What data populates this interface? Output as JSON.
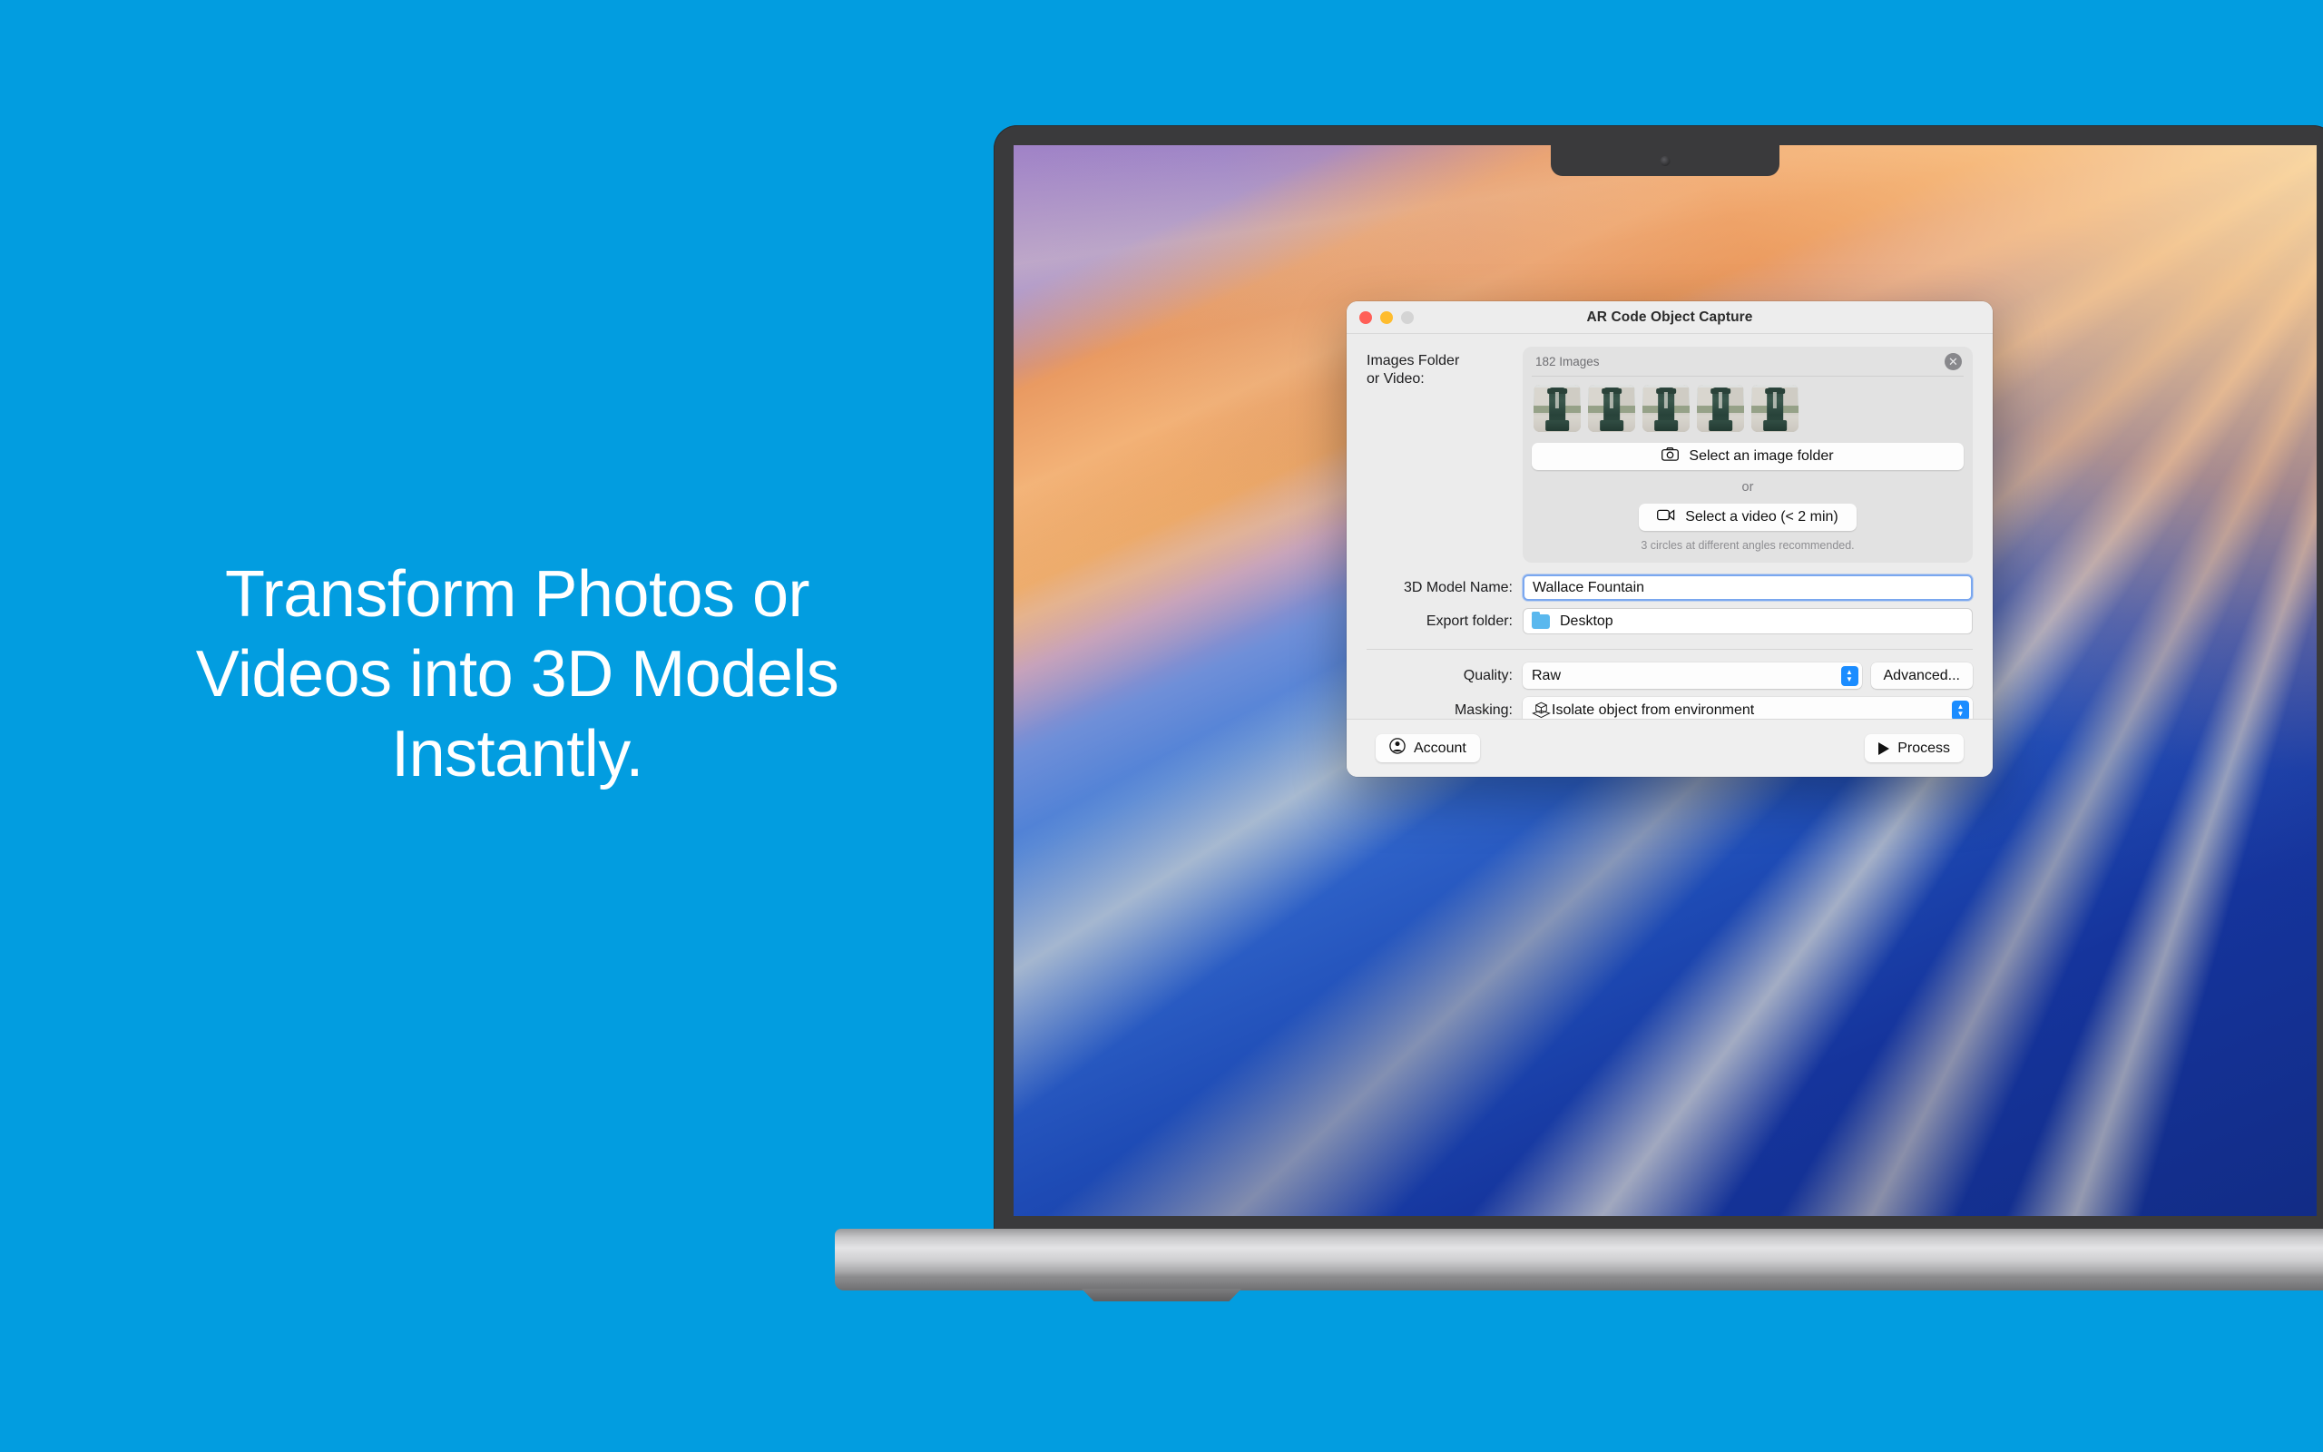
{
  "marketing": {
    "headline": "Transform Photos or\nVideos into 3D Models\nInstantly.",
    "background_color": "#029DE0",
    "text_color": "#FFFFFF"
  },
  "window": {
    "title": "AR Code Object Capture",
    "traffic_lights": [
      "close-red",
      "minimize-yellow",
      "zoom-gray-disabled"
    ]
  },
  "images_section": {
    "label": "Images Folder\nor Video:",
    "count_text": "182 Images",
    "clear_icon": "close-circle-icon",
    "thumbnail_count": 5,
    "thumbnail_subject": "Wallace Fountain statue photos",
    "select_folder_button": "Select an image folder",
    "select_folder_icon": "camera-icon",
    "or_text": "or",
    "select_video_button": "Select a video (< 2 min)",
    "select_video_icon": "video-camera-icon",
    "hint": "3 circles at different angles recommended."
  },
  "fields": {
    "model_name_label": "3D Model Name:",
    "model_name_value": "Wallace Fountain",
    "model_name_focused": true,
    "export_folder_label": "Export folder:",
    "export_folder_value": "Desktop",
    "export_folder_icon": "folder-icon"
  },
  "options": {
    "quality_label": "Quality:",
    "quality_value": "Raw",
    "quality_options": [
      "Raw"
    ],
    "advanced_button": "Advanced...",
    "masking_label": "Masking:",
    "masking_value": "Isolate object from environment",
    "masking_icon": "cube-on-plane-icon",
    "masking_options": [
      "Isolate object from environment"
    ],
    "stepper_color": "#1A8CFF"
  },
  "footer": {
    "account_button": "Account",
    "account_icon": "person-circle-icon",
    "process_button": "Process",
    "process_icon": "play-triangle-icon"
  }
}
